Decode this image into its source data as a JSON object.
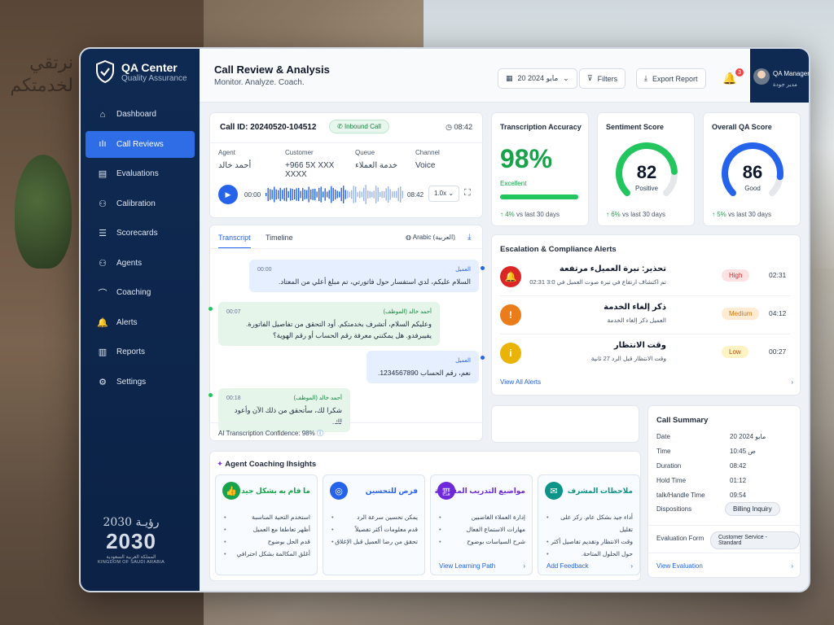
{
  "background": {
    "arabic_sign": "نرتقي لخدمتكم"
  },
  "brand": {
    "title": "QA Center",
    "subtitle": "Quality Assurance"
  },
  "nav": [
    {
      "label": "Dashboard",
      "icon": "home-icon"
    },
    {
      "label": "Call Reviews",
      "icon": "waveform-icon",
      "active": true
    },
    {
      "label": "Evaluations",
      "icon": "clipboard-icon"
    },
    {
      "label": "Calibration",
      "icon": "users-icon"
    },
    {
      "label": "Scorecards",
      "icon": "scorecard-icon"
    },
    {
      "label": "Agents",
      "icon": "agents-icon"
    },
    {
      "label": "Coaching",
      "icon": "graduation-cap-icon"
    },
    {
      "label": "Alerts",
      "icon": "bell-icon"
    },
    {
      "label": "Reports",
      "icon": "bar-chart-icon"
    },
    {
      "label": "Settings",
      "icon": "gear-icon"
    }
  ],
  "vision": {
    "arabic": "رؤيـة 2030",
    "number": "2030",
    "arabic_kingdom": "المملكة العربية السعودية",
    "english": "KINGDOM OF SAUDI ARABIA"
  },
  "header": {
    "title": "Call Review & Analysis",
    "subtitle": "Monitor. Analyze. Coach.",
    "date": "20 مايو 2024",
    "filters": "Filters",
    "export": "Export Report",
    "notifications": "3",
    "user_name": "QA Manager",
    "user_role": "مدير جودة"
  },
  "call": {
    "id_label": "Call ID:",
    "id": "20240520-104512",
    "type": "Inbound Call",
    "duration": "08:42",
    "fields": [
      {
        "label": "Agent",
        "value": "أحمد خالد"
      },
      {
        "label": "Customer",
        "value": "+966 5X XXX XXXX"
      },
      {
        "label": "Queue",
        "value": "خدمة العملاء"
      },
      {
        "label": "Channel",
        "value": "Voice"
      }
    ],
    "player": {
      "start": "00:00",
      "end": "08:42",
      "speed": "1.0x"
    }
  },
  "metrics": {
    "transcription": {
      "title": "Transcription Accuracy",
      "value": "98%",
      "label": "Excellent",
      "progress": 0.98,
      "delta": "4%",
      "delta_text": "vs last 30 days"
    },
    "sentiment": {
      "title": "Sentiment Score",
      "value": "82",
      "label": "Positive",
      "fraction": 0.82,
      "delta": "6%",
      "delta_text": "vs last 30 days"
    },
    "qa": {
      "title": "Overall QA Score",
      "value": "86",
      "label": "Good",
      "fraction": 0.86,
      "delta": "5%",
      "delta_text": "vs last 30 days"
    }
  },
  "transcript": {
    "tabs": [
      "Transcript",
      "Timeline"
    ],
    "language": "Arabic (العربية)",
    "messages": [
      {
        "speaker": "العميل",
        "time": "00:00",
        "text": "السلام عليكم، لدي استفسار حول فاتورتي، تم مبلغ أعلي من المعتاد."
      },
      {
        "speaker": "أحمد خالد (الموظف)",
        "time": "00:07",
        "text": "وعليكم السلام، أتشرف بخدمتكم. أود التحقق من تفاصيل الفاتورة. يفيبرفدو. هل يمكنني معرفة رقم الحساب أو رقم الهوية؟"
      },
      {
        "speaker": "العميل",
        "time": "",
        "text": "نعم، رقم الحساب 1234567890."
      },
      {
        "speaker": "أحمد خالد (الموظف)",
        "time": "00:18",
        "text": "شكرا لك، سأتحقق من ذلك الآن وأعود لك."
      }
    ],
    "confidence": "AI Transcription Confidence: 98%"
  },
  "alerts": {
    "title": "Escalation & Compliance Alerts",
    "items": [
      {
        "title": "تحذير: نبرة العميلء مرتفعة",
        "desc": "تم اكتشاف ارتفاع في نبرة صوت العميل في 3:0 02:31",
        "severity": "High",
        "time": "02:31",
        "color": "#dc2626",
        "badge_bg": "#fde2e4",
        "badge_fg": "#dc2626",
        "icon": "bell-icon"
      },
      {
        "title": "ذكر إلغاء الخدمة",
        "desc": "العميل ذكر إلغاء الخدمة",
        "severity": "Medium",
        "time": "04:12",
        "color": "#ea7c1a",
        "badge_bg": "#fdebd3",
        "badge_fg": "#d97706",
        "icon": "warning-icon"
      },
      {
        "title": "وقت الانتظار",
        "desc": "وقت الانتظار قبل الرد 27 ثانية",
        "severity": "Low",
        "time": "00:27",
        "color": "#eab308",
        "badge_bg": "#fdf3c4",
        "badge_fg": "#b45309",
        "icon": "info-icon"
      }
    ],
    "view_all": "View All Alerts"
  },
  "summary": {
    "title": "Call Summary",
    "rows": [
      {
        "label": "Date",
        "value": "20 مايو 2024"
      },
      {
        "label": "Time",
        "value": "10:45 ص"
      },
      {
        "label": "Duration",
        "value": "08:42"
      },
      {
        "label": "Hold Time",
        "value": "01:12"
      },
      {
        "label": "talk/Handle Time",
        "value": "09:54"
      }
    ],
    "disposition_label": "Dispositions",
    "disposition": "Billing Inquiry",
    "form_label": "Evaluation Form",
    "form": "Customer Service - Standard",
    "view": "View Evaluation"
  },
  "coaching": {
    "title": "Agent Coaching Ihsights",
    "cards": [
      {
        "title": "ما قام به بشكل جيد",
        "color": "#16a34a",
        "icon": "thumbs-up-icon",
        "items": [
          "استخدم التحية المناسبة",
          "أظهر تعاطفا مع العميل",
          "قدم الحل بوضوح",
          "أغلق المكالمة بشكل احترافي"
        ],
        "link": ""
      },
      {
        "title": "فرص للتحسين",
        "color": "#2563eb",
        "icon": "target-icon",
        "items": [
          "يمكن تحسين سرعة الرد",
          "قدم معلومات أكثر تفصيلاً",
          "تحقق من رضا العميل قبل الإغلاق"
        ],
        "link": ""
      },
      {
        "title": "مواضيع التدريب المقترحة",
        "color": "#6d28d9",
        "icon": "book-icon",
        "items": [
          "إدارة العملاء الغاضبين",
          "مهارات الاستماع الفعال",
          "شرح السياسات بوضوح"
        ],
        "link": "View Learning Path"
      },
      {
        "title": "ملاحظات المشرف",
        "color": "#0d9488",
        "icon": "comment-icon",
        "items": [
          "أداء جيد بشكل عام. ركز على تقليل",
          "وقت الانتظار وتقديم تفاصيل أكثر",
          "حول الحلول المتاحة."
        ],
        "link": "Add Feedback"
      }
    ]
  }
}
